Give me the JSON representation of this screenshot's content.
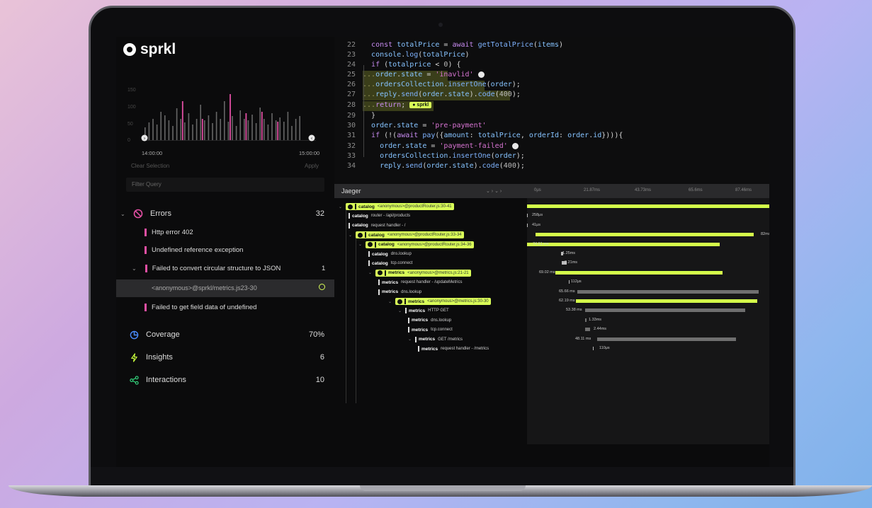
{
  "app": {
    "name": "sprkl"
  },
  "histogram": {
    "y_ticks": [
      "150",
      "100",
      "50",
      "0"
    ],
    "x_start": "14:00:00",
    "x_end": "15:00:00",
    "clear_label": "Clear Selection",
    "apply_label": "Apply",
    "bars_gray": [
      18,
      25,
      30,
      22,
      40,
      35,
      28,
      20,
      45,
      30,
      25,
      38,
      22,
      30,
      50,
      28,
      35,
      24,
      40,
      30,
      55,
      26,
      34,
      20,
      42,
      30,
      28,
      36,
      24,
      46,
      30,
      22,
      38,
      28,
      32,
      26,
      40,
      20,
      30,
      34
    ],
    "bars_pink": [
      {
        "i": 9,
        "v": 55
      },
      {
        "i": 14,
        "v": 30
      },
      {
        "i": 21,
        "v": 65
      },
      {
        "i": 25,
        "v": 38
      },
      {
        "i": 29,
        "v": 40
      },
      {
        "i": 33,
        "v": 26
      }
    ]
  },
  "filter": {
    "placeholder": "Filter Query"
  },
  "errors": {
    "label": "Errors",
    "count": "32",
    "items": [
      {
        "text": "Http error 402"
      },
      {
        "text": "Undefined reference exception"
      },
      {
        "text": "Failed to convert circular structure to JSON",
        "count": "1"
      },
      {
        "text": "<anonymous>@sprkl/metrics.js23-30"
      },
      {
        "text": "Failed to get field data of undefined"
      }
    ]
  },
  "sections": [
    {
      "label": "Coverage",
      "value": "70%",
      "icon": "pie-chart-icon",
      "color": "#4a8cff"
    },
    {
      "label": "Insights",
      "value": "6",
      "icon": "lightning-icon",
      "color": "#c9ff3c"
    },
    {
      "label": "Interactions",
      "value": "10",
      "icon": "share-icon",
      "color": "#32d07a"
    }
  ],
  "code": {
    "line_numbers": [
      "22",
      "23",
      "24",
      "25",
      "26",
      "27",
      "28",
      "29",
      "30",
      "31",
      "32",
      "33",
      "34"
    ],
    "chip_label": "sprkl"
  },
  "jaeger": {
    "title": "Jaeger",
    "header_controls": "⌄ › ⌄ ›",
    "ticks": [
      "0μs",
      "21.87ms",
      "43.73ms",
      "65.6ms",
      "87.46ms"
    ],
    "rows": [
      {
        "svc": "catalog",
        "op": "<anonymous>@productRouter.js:30-41",
        "badge": true,
        "indent": 0,
        "chev": "⌄"
      },
      {
        "svc": "catalog",
        "op": "router - /api/products",
        "badge": false,
        "indent": 1,
        "chev": ""
      },
      {
        "svc": "catalog",
        "op": "request handler - /",
        "badge": false,
        "indent": 1,
        "chev": ""
      },
      {
        "svc": "catalog",
        "op": "<anonymous>@productRouter.js:33-34",
        "badge": true,
        "indent": 1,
        "chev": "⌄"
      },
      {
        "svc": "catalog",
        "op": "<anonymous>@productRouter.js:34-36",
        "badge": true,
        "indent": 2,
        "chev": "⌄"
      },
      {
        "svc": "catalog",
        "op": "dns.lookup",
        "badge": false,
        "indent": 3,
        "chev": ""
      },
      {
        "svc": "catalog",
        "op": "tcp.connect",
        "badge": false,
        "indent": 3,
        "chev": ""
      },
      {
        "svc": "metrics",
        "op": "<anonymous>@metrics.js:21-21",
        "badge": true,
        "indent": 3,
        "chev": "⌄"
      },
      {
        "svc": "metrics",
        "op": "request handler - /updateMetrics",
        "badge": false,
        "indent": 4,
        "chev": ""
      },
      {
        "svc": "metrics",
        "op": "dns.lookup",
        "badge": false,
        "indent": 4,
        "chev": ""
      },
      {
        "svc": "metrics",
        "op": "<anonymous>@metrics.js:30-30",
        "badge": true,
        "indent": 5,
        "chev": "⌄"
      },
      {
        "svc": "metrics",
        "op": "HTTP GET",
        "badge": false,
        "indent": 6,
        "chev": "⌄"
      },
      {
        "svc": "metrics",
        "op": "dns.lookup",
        "badge": false,
        "indent": 7,
        "chev": ""
      },
      {
        "svc": "metrics",
        "op": "tcp.connect",
        "badge": false,
        "indent": 7,
        "chev": ""
      },
      {
        "svc": "metrics",
        "op": "GET /metrics",
        "badge": false,
        "indent": 7,
        "chev": "⌄"
      },
      {
        "svc": "metrics",
        "op": "request handler - /metrics",
        "badge": false,
        "indent": 8,
        "chev": ""
      }
    ],
    "spans": [
      {
        "label": "",
        "kind": "g"
      },
      {
        "label": "258μs",
        "kind": "w"
      },
      {
        "label": "41μs",
        "kind": "w"
      },
      {
        "label": "82ms",
        "kind": "g"
      },
      {
        "label": "74.61 ms",
        "kind": "g"
      },
      {
        "label": "1.25ms",
        "kind": "w"
      },
      {
        "label": "2.21ms",
        "kind": "w"
      },
      {
        "label": "69.02 ms",
        "kind": "g"
      },
      {
        "label": "112μs",
        "kind": "w"
      },
      {
        "label": "65.66 ms",
        "kind": "d"
      },
      {
        "label": "62.19 ms",
        "kind": "g"
      },
      {
        "label": "53.38 ms",
        "kind": "d"
      },
      {
        "label": "1.33ms",
        "kind": "d"
      },
      {
        "label": "2.44ms",
        "kind": "d"
      },
      {
        "label": "48.11 ms",
        "kind": "d"
      },
      {
        "label": "110μs",
        "kind": "w"
      }
    ]
  }
}
